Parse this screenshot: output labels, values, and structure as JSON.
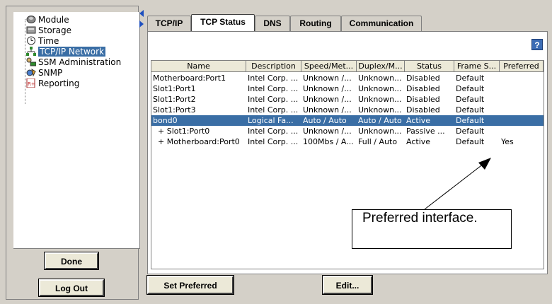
{
  "tree": {
    "items": [
      {
        "label": "Module",
        "icon": "module-icon"
      },
      {
        "label": "Storage",
        "icon": "storage-icon"
      },
      {
        "label": "Time",
        "icon": "clock-icon"
      },
      {
        "label": "TCP/IP Network",
        "icon": "network-icon",
        "selected": true
      },
      {
        "label": "SSM Administration",
        "icon": "admin-icon"
      },
      {
        "label": "SNMP",
        "icon": "snmp-icon"
      },
      {
        "label": "Reporting",
        "icon": "report-icon"
      }
    ]
  },
  "left_buttons": {
    "done": "Done",
    "logout": "Log Out"
  },
  "tabs": [
    {
      "label": "TCP/IP"
    },
    {
      "label": "TCP Status",
      "active": true
    },
    {
      "label": "DNS"
    },
    {
      "label": "Routing"
    },
    {
      "label": "Communication"
    }
  ],
  "help_label": "?",
  "table": {
    "headers": [
      "Name",
      "Description",
      "Speed/Met...",
      "Duplex/M...",
      "Status",
      "Frame S...",
      "Preferred"
    ],
    "rows": [
      [
        "Motherboard:Port1",
        "Intel Corp. ...",
        "Unknown /...",
        "Unknown...",
        "Disabled",
        "Default",
        ""
      ],
      [
        "Slot1:Port1",
        "Intel Corp. ...",
        "Unknown /...",
        "Unknown...",
        "Disabled",
        "Default",
        ""
      ],
      [
        "Slot1:Port2",
        "Intel Corp. ...",
        "Unknown /...",
        "Unknown...",
        "Disabled",
        "Default",
        ""
      ],
      [
        "Slot1:Port3",
        "Intel Corp. ...",
        "Unknown /...",
        "Unknown...",
        "Disabled",
        "Default",
        ""
      ],
      [
        "bond0",
        "Logical Fa...",
        "Auto / Auto",
        "Auto / Auto",
        "Active",
        "Default",
        ""
      ],
      [
        "  + Slot1:Port0",
        "Intel Corp. ...",
        "Unknown /...",
        "Unknown...",
        "Passive ...",
        "Default",
        ""
      ],
      [
        "  + Motherboard:Port0",
        "Intel Corp. ...",
        "100Mbs / A...",
        "Full / Auto",
        "Active",
        "Default",
        "Yes"
      ]
    ],
    "selected_row": 4
  },
  "buttons": {
    "set_preferred": "Set Preferred",
    "edit": "Edit..."
  },
  "callout": "Preferred interface.",
  "colors": {
    "selection": "#3a6ea5",
    "background": "#d4d0c8",
    "help": "#3d6db5"
  }
}
